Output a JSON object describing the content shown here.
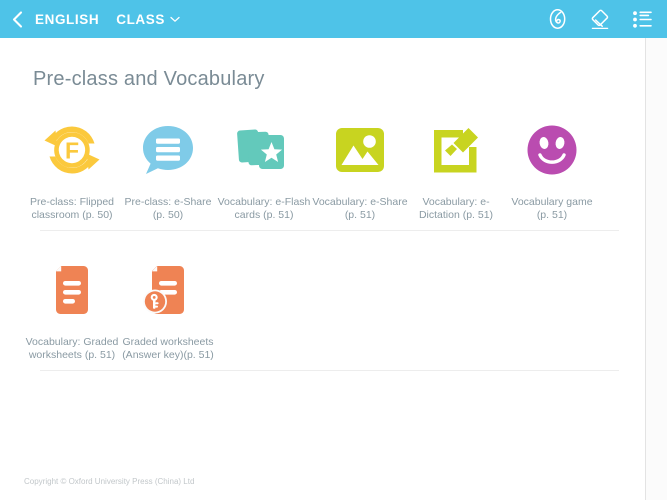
{
  "header": {
    "back_icon": "chevron-left-icon",
    "title": "ENGLISH",
    "class_label": "CLASS",
    "class_chevron": "chevron-down-icon",
    "bg_color": "#4ec3e8",
    "actions": [
      {
        "name": "pen-tool-icon",
        "label": "Pen"
      },
      {
        "name": "eraser-tool-icon",
        "label": "Eraser"
      },
      {
        "name": "list-menu-icon",
        "label": "List"
      }
    ]
  },
  "main": {
    "title": "Pre-class and Vocabulary",
    "rows": [
      {
        "tiles": [
          {
            "icon": "flipped-classroom-icon",
            "color": "#fbc93d",
            "label": "Pre-class: Flipped classroom (p. 50)"
          },
          {
            "icon": "e-share-chat-icon",
            "color": "#7fcbe8",
            "label": "Pre-class: e-Share (p. 50)"
          },
          {
            "icon": "e-flash-cards-icon",
            "color": "#63c9bb",
            "label": "Vocabulary: e-Flash cards (p. 51)"
          },
          {
            "icon": "e-share-image-icon",
            "color": "#c8d420",
            "label": "Vocabulary: e-Share (p. 51)"
          },
          {
            "icon": "e-dictation-icon",
            "color": "#c8d420",
            "label": "Vocabulary: e-Dictation (p. 51)"
          },
          {
            "icon": "vocabulary-game-smiley-icon",
            "color": "#b details",
            "label": "Vocabulary game (p. 51)"
          }
        ]
      },
      {
        "tiles": [
          {
            "icon": "graded-worksheets-icon",
            "color": "#ef8354",
            "label": "Vocabulary: Graded worksheets (p. 51)"
          },
          {
            "icon": "graded-worksheets-answer-key-icon",
            "color": "#ef8354",
            "label": "Graded worksheets (Answer key)(p. 51)"
          }
        ]
      }
    ]
  },
  "footer": {
    "copyright": "Copyright © Oxford University Press (China) Ltd"
  }
}
